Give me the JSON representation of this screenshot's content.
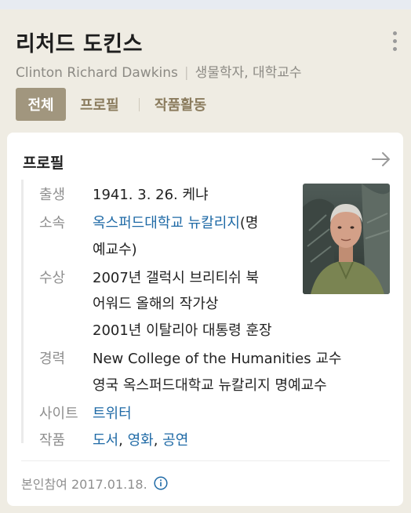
{
  "header": {
    "name": "리처드 도킨스",
    "english_name": "Clinton Richard Dawkins",
    "occupation": "생물학자, 대학교수",
    "tabs": [
      {
        "label": "전체",
        "active": true
      },
      {
        "label": "프로필",
        "active": false
      },
      {
        "label": "작품활동",
        "active": false
      }
    ],
    "more_icon": "more-vertical-icon"
  },
  "profile": {
    "title": "프로필",
    "arrow_icon": "arrow-right-icon",
    "birth": {
      "label": "출생",
      "value": "1941. 3. 26. 케냐"
    },
    "affiliation": {
      "label": "소속",
      "link": "옥스퍼드대학교 뉴칼리지",
      "rest_1": "(명",
      "rest_2": "예교수)"
    },
    "awards": {
      "label": "수상",
      "lines": [
        "2007년 갤럭시 브리티쉬 북",
        "어워드 올해의 작가상",
        "2001년 이탈리아 대통령 훈장"
      ]
    },
    "career": {
      "label": "경력",
      "lines": [
        "New College of the Humanities 교수",
        "영국 옥스퍼드대학교 뉴칼리지 명예교수"
      ]
    },
    "site": {
      "label": "사이트",
      "link": "트위터"
    },
    "works": {
      "label": "작품",
      "links": [
        "도서",
        "영화",
        "공연"
      ],
      "separator": ", "
    },
    "footer": {
      "text": "본인참여 2017.01.18.",
      "info_icon": "info-icon"
    }
  },
  "colors": {
    "background": "#efece3",
    "active_tab": "#a1967e",
    "tab_text": "#8b7c5e",
    "link": "#1f6aa6"
  }
}
